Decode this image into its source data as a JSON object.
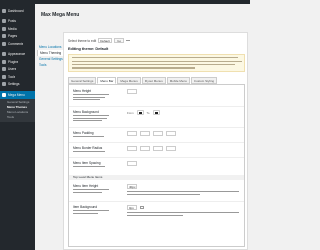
{
  "sidebar": {
    "items": [
      {
        "label": "Dashboard",
        "icon": "dashboard-icon"
      },
      {
        "label": "Posts",
        "icon": "pin-icon"
      },
      {
        "label": "Media",
        "icon": "media-icon"
      },
      {
        "label": "Pages",
        "icon": "page-icon"
      },
      {
        "label": "Comments",
        "icon": "comment-icon"
      },
      {
        "label": "Appearance",
        "icon": "brush-icon"
      },
      {
        "label": "Plugins",
        "icon": "plugin-icon"
      },
      {
        "label": "Users",
        "icon": "user-icon"
      },
      {
        "label": "Tools",
        "icon": "wrench-icon"
      },
      {
        "label": "Settings",
        "icon": "settings-icon"
      },
      {
        "label": "Mega Menu",
        "icon": "menu-icon"
      }
    ],
    "submenu": [
      "General Settings",
      "Menu Themes",
      "Menu Locations",
      "Tools"
    ]
  },
  "page": {
    "title": "Max Mega Menu"
  },
  "left_tabs": [
    "Menu Locations",
    "Menu Theming",
    "General Settings",
    "Tools"
  ],
  "theme_select": {
    "label": "Select theme to edit",
    "value": "Default",
    "button": "Go"
  },
  "edit_title": "Editing theme: Default",
  "subtabs": [
    "General Settings",
    "Menu Bar",
    "Mega Menus",
    "Flyout Menus",
    "Mobile Menu",
    "Custom Styling"
  ],
  "rows": [
    {
      "label": "Menu Height"
    },
    {
      "label": "Menu Background",
      "from": "From",
      "to": "To"
    },
    {
      "label": "Menu Padding"
    },
    {
      "label": "Menu Border Radius"
    },
    {
      "label": "Menu Item Spacing"
    }
  ],
  "section": "Top Level Menu Items",
  "item_rows": [
    {
      "label": "Menu Item Height",
      "value": "40px"
    },
    {
      "label": "Item Background",
      "value": "0px"
    }
  ],
  "colors": {
    "adminbar": "#23282d",
    "sidebar": "#23282d",
    "accent": "#0073aa",
    "notice": "#fcf8e3"
  }
}
